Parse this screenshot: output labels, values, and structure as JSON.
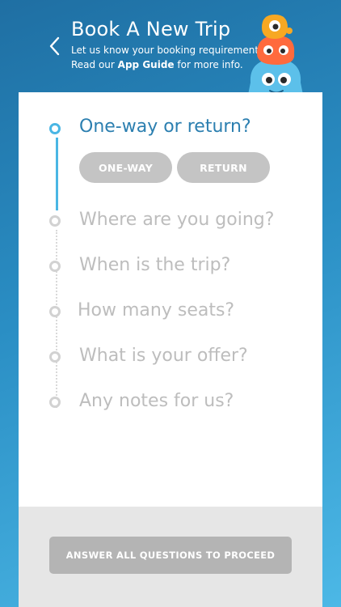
{
  "header": {
    "title": "Book A New Trip",
    "subtitle_line1": "Let us know your booking requirements.",
    "subtitle_line2_pre": "Read our ",
    "subtitle_line2_link": "App Guide",
    "subtitle_line2_post": " for more info."
  },
  "steps": [
    {
      "label": "One-way or return?",
      "state": "active"
    },
    {
      "label": "Where are you going?",
      "state": "inactive"
    },
    {
      "label": "When is the trip?",
      "state": "inactive"
    },
    {
      "label": "How many seats?",
      "state": "inactive"
    },
    {
      "label": "What is your offer?",
      "state": "inactive"
    },
    {
      "label": "Any notes for us?",
      "state": "inactive"
    }
  ],
  "options": {
    "one_way": "ONE-WAY",
    "return": "RETURN"
  },
  "footer": {
    "proceed_label": "ANSWER ALL QUESTIONS TO PROCEED"
  },
  "colors": {
    "accent": "#4ab6e4",
    "active_text": "#2c7fb0",
    "inactive_text": "#bdbdbd",
    "button_gray": "#c4c4c4"
  }
}
